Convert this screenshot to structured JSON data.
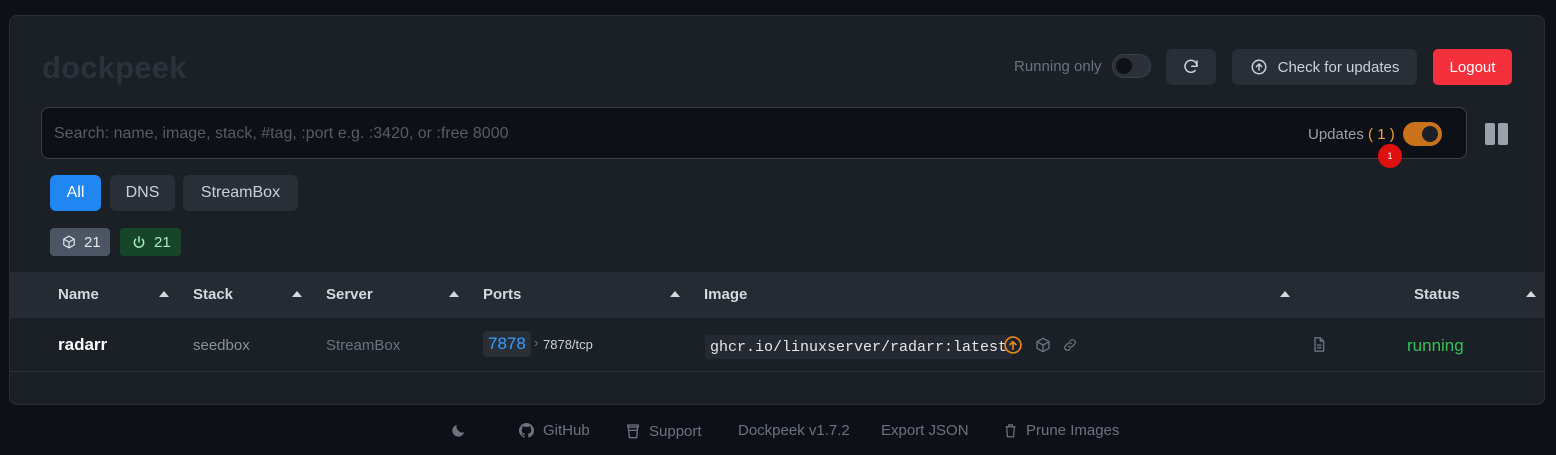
{
  "app": {
    "logo": "dockpeek"
  },
  "header": {
    "running_only_label": "Running only",
    "running_only_on": false,
    "check_updates_label": "Check for updates",
    "logout_label": "Logout"
  },
  "search": {
    "placeholder": "Search: name, image, stack, #tag, :port e.g. :3420, or :free 8000",
    "value": "",
    "updates_label": "Updates",
    "updates_count": "( 1 )",
    "updates_toggle_on": true,
    "notification_badge": "1"
  },
  "filters": [
    {
      "label": "All",
      "active": true
    },
    {
      "label": "DNS",
      "active": false
    },
    {
      "label": "StreamBox",
      "active": false
    }
  ],
  "counts": {
    "total": "21",
    "running": "21"
  },
  "table": {
    "columns": [
      "Name",
      "Stack",
      "Server",
      "Ports",
      "Image",
      "Status"
    ],
    "rows": [
      {
        "name": "radarr",
        "stack": "seedbox",
        "server": "StreamBox",
        "host_port": "7878",
        "container_port": "7878/tcp",
        "image": "ghcr.io/linuxserver/radarr:latest",
        "status": "running"
      }
    ]
  },
  "footer": {
    "github": "GitHub",
    "support": "Support",
    "version": "Dockpeek v1.7.2",
    "export": "Export JSON",
    "prune": "Prune Images"
  },
  "colors": {
    "accent": "#1f86f2",
    "logout": "#f4303d",
    "updates_toggle": "#c9721c",
    "running_status": "#34c05a",
    "badge": "#e11010"
  }
}
